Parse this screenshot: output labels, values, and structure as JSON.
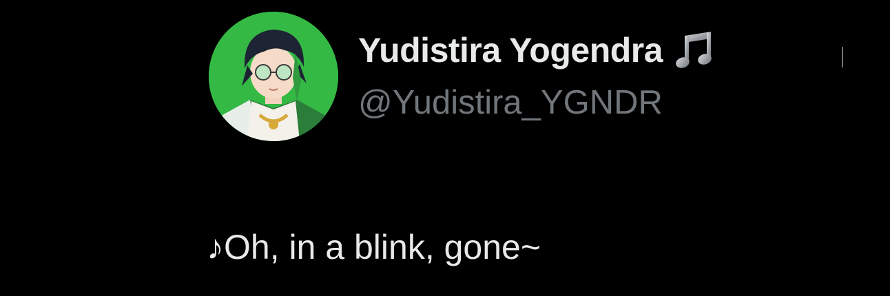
{
  "author": {
    "display_name": "Yudistira Yogendra",
    "name_emoji_icon": "musical-notes-icon",
    "handle": "@Yudistira_YGNDR",
    "avatar": "anime-avatar-green-background"
  },
  "tweet": {
    "text": "♪Oh, in a blink, gone~"
  },
  "colors": {
    "background": "#000000",
    "primary_text": "#e7e9ea",
    "secondary_text": "#71767b",
    "avatar_background": "#35b945"
  }
}
